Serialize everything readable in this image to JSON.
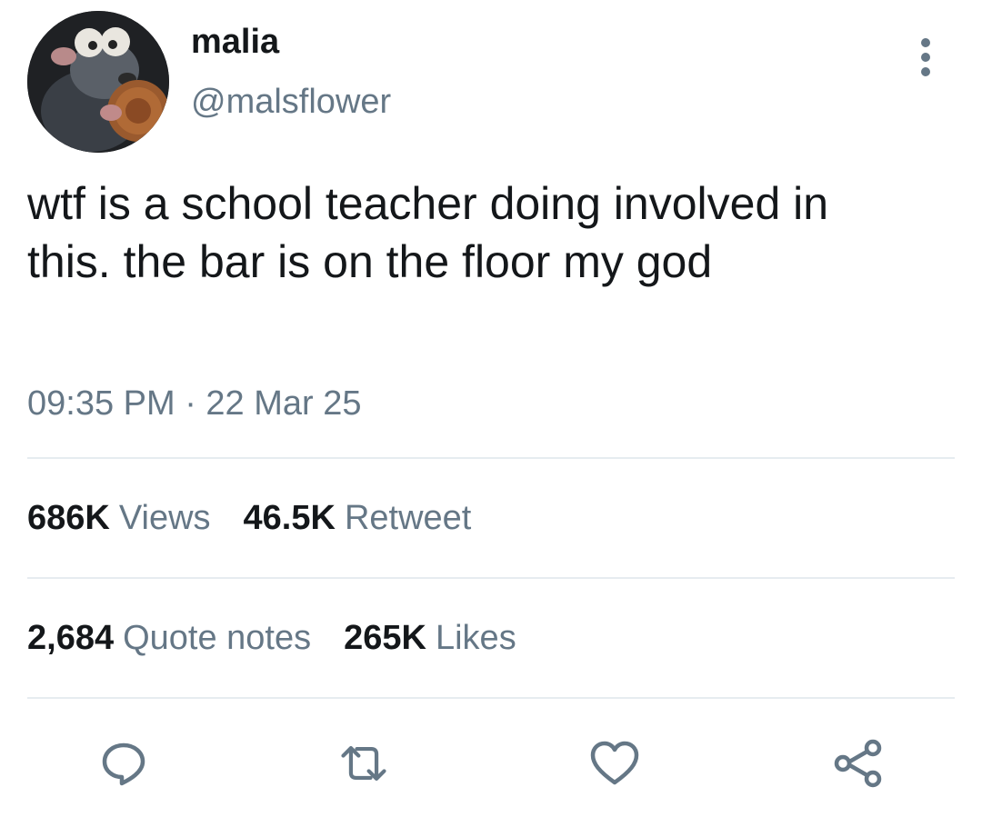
{
  "user": {
    "display_name": "malia",
    "handle": "@malsflower"
  },
  "tweet": {
    "text": "wtf is a school teacher doing involved in\nthis. the bar is on the floor my god",
    "timestamp": "09:35 PM · 22 Mar 25"
  },
  "stats": {
    "views_count": "686K",
    "views_label": "Views",
    "retweets_count": "46.5K",
    "retweets_label": "Retweet",
    "quotes_count": "2,684",
    "quotes_label": "Quote notes",
    "likes_count": "265K",
    "likes_label": "Likes"
  },
  "actions": {
    "reply_icon": "comment-bubble-icon",
    "retweet_icon": "retweet-arrows-icon",
    "like_icon": "heart-icon",
    "share_icon": "share-nodes-icon"
  },
  "colors": {
    "text_primary": "#14171a",
    "text_secondary": "#657786",
    "divider": "#e6ecf0"
  }
}
